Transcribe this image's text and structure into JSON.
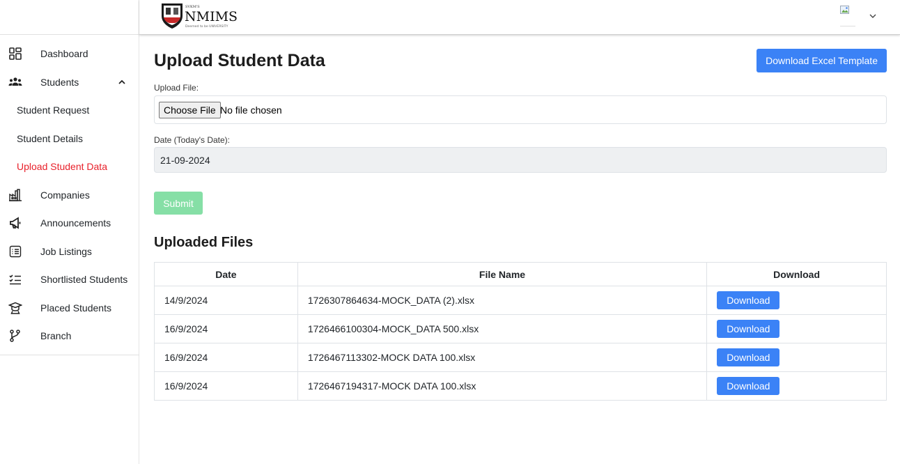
{
  "header": {
    "logo_small": "SVKM'S",
    "logo_main": "NMIMS",
    "logo_sub": "Deemed to be UNIVERSITY"
  },
  "sidebar": {
    "items": [
      {
        "label": "Dashboard",
        "icon": "dashboard-icon"
      },
      {
        "label": "Students",
        "icon": "students-icon"
      },
      {
        "label": "Student Request"
      },
      {
        "label": "Student Details"
      },
      {
        "label": "Upload Student Data",
        "active": true
      },
      {
        "label": "Companies",
        "icon": "factory-icon"
      },
      {
        "label": "Announcements",
        "icon": "megaphone-icon"
      },
      {
        "label": "Job Listings",
        "icon": "list-icon"
      },
      {
        "label": "Shortlisted Students",
        "icon": "checklist-icon"
      },
      {
        "label": "Placed Students",
        "icon": "graduate-icon"
      },
      {
        "label": "Branch",
        "icon": "branch-icon"
      }
    ]
  },
  "main": {
    "title": "Upload Student Data",
    "template_button": "Download Excel Template",
    "upload_label": "Upload File:",
    "choose_file": "Choose File",
    "file_status": "No file chosen",
    "date_label": "Date (Today's Date):",
    "date_value": "21-09-2024",
    "submit": "Submit",
    "uploaded_title": "Uploaded Files",
    "table": {
      "headers": [
        "Date",
        "File Name",
        "Download"
      ],
      "rows": [
        {
          "date": "14/9/2024",
          "file": "1726307864634-MOCK_DATA (2).xlsx",
          "action": "Download"
        },
        {
          "date": "16/9/2024",
          "file": "1726466100304-MOCK_DATA 500.xlsx",
          "action": "Download"
        },
        {
          "date": "16/9/2024",
          "file": "1726467113302-MOCK DATA 100.xlsx",
          "action": "Download"
        },
        {
          "date": "16/9/2024",
          "file": "1726467194317-MOCK DATA 100.xlsx",
          "action": "Download"
        }
      ]
    }
  },
  "colors": {
    "primary": "#3b82f6",
    "active_nav": "#e8202a",
    "submit_disabled": "#86dfa6",
    "date_bg": "#eef0f2"
  }
}
